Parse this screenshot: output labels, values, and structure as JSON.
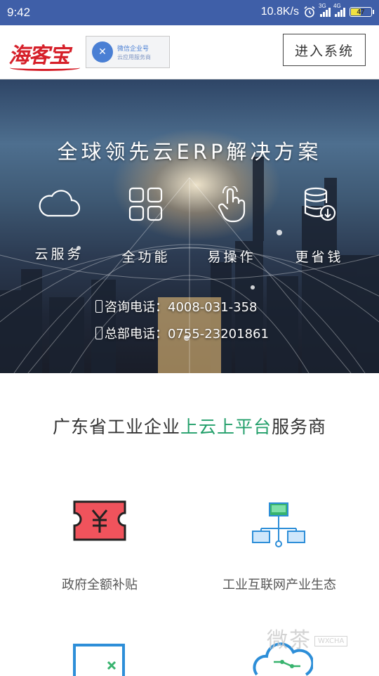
{
  "status_bar": {
    "time": "9:42",
    "net_speed": "10.8K/s",
    "sim1_type": "3G",
    "sim2_type": "4G",
    "battery": "47",
    "battery_level": 0.47
  },
  "header": {
    "logo_text": "海客宝",
    "badge_line1": "微信企业号",
    "badge_line2": "云应用服务商",
    "enter_button": "进入系统"
  },
  "hero": {
    "title": "全球领先云ERP解决方案",
    "features": [
      {
        "label": "云服务",
        "icon": "cloud-icon"
      },
      {
        "label": "全功能",
        "icon": "grid-icon"
      },
      {
        "label": "易操作",
        "icon": "tap-hand-icon"
      },
      {
        "label": "更省钱",
        "icon": "coins-icon"
      }
    ],
    "contact_phone": "咨询电话：4008-031-358",
    "hq_phone": "总部电话：0755-23201861"
  },
  "section": {
    "title_prefix": "广东省工业企业",
    "title_highlight": "上云上平台",
    "title_suffix": "服务商",
    "services": [
      {
        "label": "政府全额补贴",
        "icon": "ticket-yen-icon"
      },
      {
        "label": "工业互联网产业生态",
        "icon": "network-icon"
      }
    ]
  },
  "watermark": {
    "text": "微茶",
    "tag": "WXCHA"
  },
  "colors": {
    "status_bar": "#3f5fa8",
    "brand_red": "#d6202a",
    "highlight_green": "#24a06b"
  }
}
